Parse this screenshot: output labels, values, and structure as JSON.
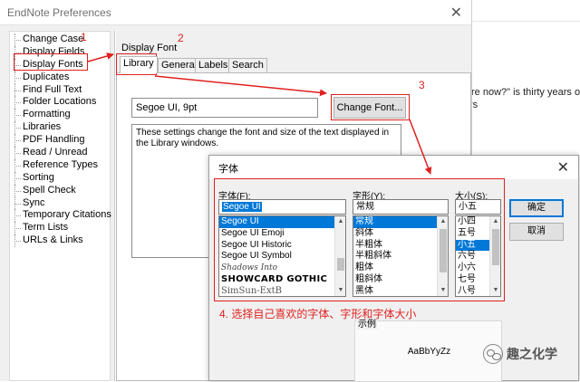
{
  "window": {
    "title": "EndNote Preferences",
    "close_glyph": "✕"
  },
  "background_app": {
    "lines": [
      "re now?\" is thirty years old. A",
      "rs"
    ]
  },
  "nav": {
    "items": [
      "Change Case",
      "Display Fields",
      "Display Fonts",
      "Duplicates",
      "Find Full Text",
      "Folder Locations",
      "Formatting",
      "Libraries",
      "PDF Handling",
      "Read / Unread",
      "Reference Types",
      "Sorting",
      "Spell Check",
      "Sync",
      "Temporary Citations",
      "Term Lists",
      "URLs & Links"
    ],
    "active": "Display Fonts"
  },
  "pane": {
    "title": "Display Font",
    "tabs": [
      "Library",
      "General",
      "Labels",
      "Search"
    ],
    "active_tab": "Library",
    "current_font": "Segoe UI, 9pt",
    "change_font_label": "Change Font...",
    "description": "These settings change the font and size of the text displayed in the Library windows."
  },
  "annotations": {
    "n1": "1",
    "n2": "2",
    "n3": "3",
    "step4": "4. 选择自己喜欢的字体、字形和字体大小",
    "color": "#e02020"
  },
  "font_dialog": {
    "title": "字体",
    "close_glyph": "✕",
    "font_label": "字体(F):",
    "font_value": "Segoe UI",
    "font_list": [
      "Segoe UI",
      "Segoe UI Emoji",
      "Segoe UI Historic",
      "Segoe UI Symbol",
      "Shadows Into",
      "SHOWCARD GOTHIC",
      "SimSun-ExtB"
    ],
    "font_selected": "Segoe UI",
    "style_label": "字形(Y):",
    "style_value": "常规",
    "style_list": [
      "常规",
      "斜体",
      "半粗体",
      "半粗斜体",
      "粗体",
      "粗斜体",
      "黑体"
    ],
    "style_selected": "常规",
    "size_label": "大小(S):",
    "size_value": "小五",
    "size_list": [
      "小四",
      "五号",
      "小五",
      "六号",
      "小六",
      "七号",
      "八号"
    ],
    "size_selected": "小五",
    "ok_label": "确定",
    "cancel_label": "取消",
    "sample_label": "示例",
    "sample_text": "AaBbYyZz"
  },
  "watermark": {
    "text": "趣之化学"
  }
}
